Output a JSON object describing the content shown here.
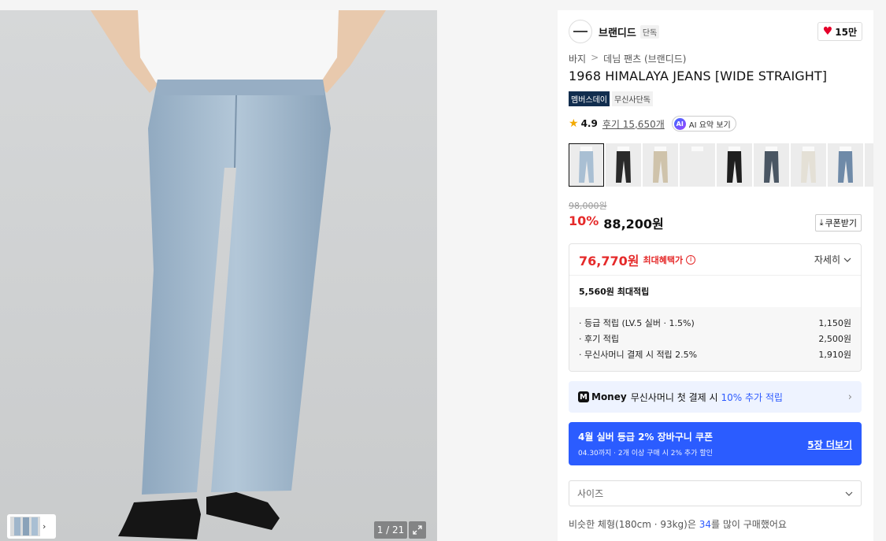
{
  "gallery": {
    "counter": "1 / 21"
  },
  "brand": {
    "name": "브랜디드",
    "tag": "단독",
    "likes": "15만"
  },
  "breadcrumb": {
    "level1": "바지",
    "separator": ">",
    "level2": "데님 팬츠 (브랜디드)"
  },
  "product": {
    "title": "1968 HIMALAYA JEANS [WIDE STRAIGHT]",
    "badge_member": "멤버스데이",
    "badge_exclusive": "무신사단독",
    "rating": "4.9",
    "reviews": "후기 15,650개",
    "ai_label": "AI 요약 보기",
    "ai_icon_text": "AI"
  },
  "swatches": {
    "colors": [
      "#a9bfd3",
      "#2a2a2a",
      "#cfc3ab",
      "#ececec",
      "#1f1f1f",
      "#4a5663",
      "#e4e0d6",
      "#6f8aa8",
      "#b4c6d6"
    ]
  },
  "price": {
    "original": "98,000원",
    "discount": "10%",
    "current": "88,200원",
    "coupon_button": "쿠폰받기"
  },
  "benefit": {
    "max_price": "76,770원",
    "max_label": "최대혜택가",
    "detail_label": "자세히",
    "points_title": "5,560원 최대적립",
    "points": [
      {
        "label": "· 등급 적립 (LV.5 실버 · 1.5%)",
        "value": "1,150원"
      },
      {
        "label": "· 후기 적립",
        "value": "2,500원"
      },
      {
        "label": "· 무신사머니 결제 시 적립 2.5%",
        "value": "1,910원"
      }
    ]
  },
  "money": {
    "brand": "Money",
    "text": "무신사머니 첫 결제 시",
    "accent": "10% 추가 적립"
  },
  "coupon_banner": {
    "title": "4월 실버 등급 2% 장바구니 쿠폰",
    "subtitle": "04.30까지 · 2개 이상 구매 시 2% 추가 할인",
    "more": "5장 더보기"
  },
  "size": {
    "placeholder": "사이즈"
  },
  "similar": {
    "prefix": "비슷한 체형(180cm · 93kg)은",
    "size": "34",
    "suffix": "를 많이 구매했어요"
  }
}
